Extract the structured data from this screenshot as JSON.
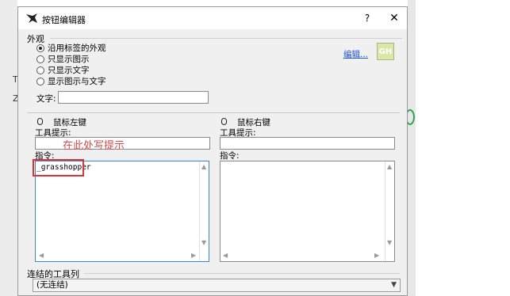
{
  "window": {
    "title": "按钮编辑器",
    "help_label": "?",
    "close_label": "✕"
  },
  "appearance": {
    "legend": "外观",
    "options": [
      "沿用标签的外观",
      "只显示图示",
      "只显示文字",
      "显示图示与文字"
    ],
    "selected_index": 0,
    "text_label": "文字:",
    "text_value": "",
    "edit_link": "编辑...",
    "icon_text": "GH"
  },
  "left_button": {
    "header": "鼠标左键",
    "tooltip_label": "工具提示:",
    "tooltip_value": "",
    "command_label": "指令:",
    "command_value": "_grasshopper"
  },
  "right_button": {
    "header": "鼠标右键",
    "tooltip_label": "工具提示:",
    "tooltip_value": "",
    "command_label": "指令:",
    "command_value": ""
  },
  "annotation": {
    "hint": "在此处写提示"
  },
  "linked_toolbar": {
    "legend": "连结的工具列",
    "selected": "(无连结)"
  }
}
